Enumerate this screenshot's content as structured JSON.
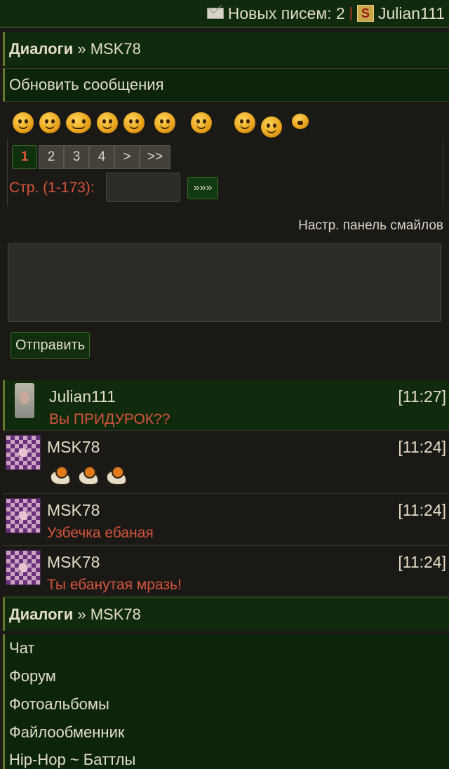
{
  "header": {
    "envelope_icon": "envelope-icon",
    "new_mail_label": "Новых писем: 2",
    "separator": "|",
    "badge_letter": "S",
    "username": "Julian111"
  },
  "breadcrumb": {
    "section": "Диалоги",
    "arrow": " » ",
    "target": "MSK78"
  },
  "refresh_label": "Обновить сообщения",
  "smileys": [
    "smiley-blush",
    "smiley-laugh",
    "smiley-love",
    "smiley-grin",
    "smiley-teeth",
    "smiley-wink",
    "smiley-shh",
    "smiley-scream",
    "smiley-smirk",
    "smiley-peek"
  ],
  "pagination": {
    "pages": [
      "1",
      "2",
      "3",
      "4",
      ">",
      ">>"
    ],
    "current": "1",
    "label": "Стр. (1-173):",
    "input_value": "",
    "go_label": "»»»"
  },
  "compose": {
    "smile_settings": "Настр. панель смайлов",
    "text_value": "",
    "send_label": "Отправить"
  },
  "messages": [
    {
      "author": "Julian111",
      "time": "[11:27]",
      "text": "Вы ПРИДУРОК??"
    },
    {
      "author": "MSK78",
      "time": "[11:24]",
      "text": ""
    },
    {
      "author": "MSK78",
      "time": "[11:24]",
      "text": "Узбечка ебаная"
    },
    {
      "author": "MSK78",
      "time": "[11:24]",
      "text": "Ты ебанутая мразь!"
    }
  ],
  "footer_breadcrumb": {
    "section": "Диалоги",
    "arrow": " » ",
    "target": "MSK78"
  },
  "menu": [
    "Чат",
    "Форум",
    "Фотоальбомы",
    "Файлообменник",
    "Hip-Hop ~ Баттлы"
  ]
}
